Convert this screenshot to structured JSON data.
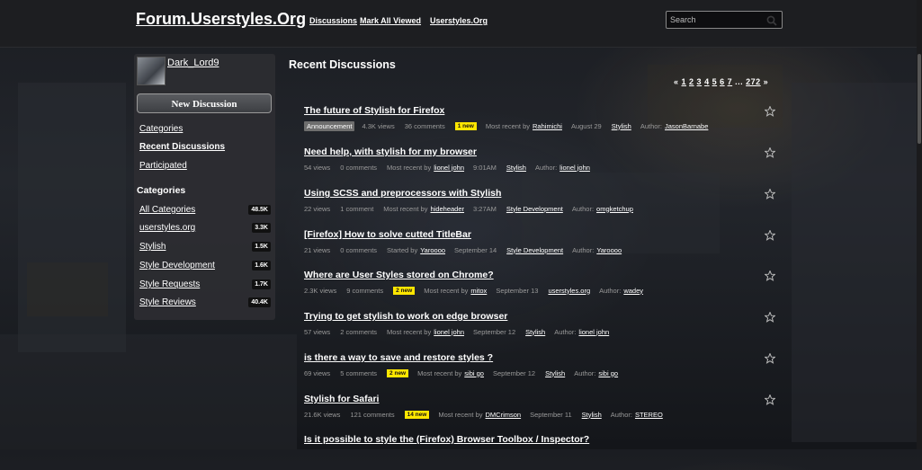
{
  "header": {
    "brand": "Forum.Userstyles.Org",
    "nav": [
      "Discussions",
      "Mark All Viewed",
      "Userstyles.Org"
    ],
    "search_placeholder": "Search"
  },
  "sidebar": {
    "username": "Dark_Lord9",
    "new_discussion": "New Discussion",
    "links": [
      "Categories",
      "Recent Discussions",
      "Participated"
    ],
    "active_link": "Recent Discussions",
    "categories_heading": "Categories",
    "categories": [
      {
        "label": "All Categories",
        "count": "48.5K"
      },
      {
        "label": "userstyles.org",
        "count": "3.3K"
      },
      {
        "label": "Stylish",
        "count": "1.5K"
      },
      {
        "label": "Style Development",
        "count": "1.6K"
      },
      {
        "label": "Style Requests",
        "count": "1.7K"
      },
      {
        "label": "Style Reviews",
        "count": "40.4K"
      }
    ]
  },
  "main": {
    "title": "Recent Discussions",
    "pager": {
      "prev": "«",
      "pages": [
        "1",
        "2",
        "3",
        "4",
        "5",
        "6",
        "7"
      ],
      "ellipsis": "...",
      "last": "272",
      "next": "»"
    },
    "discussions": [
      {
        "title": "The future of Stylish for Firefox",
        "tag": "Announcement",
        "views": "4.3K views",
        "comments": "36 comments",
        "new": "1 new",
        "recent_label": "Most recent by",
        "recent_user": "Rahimichi",
        "date": "August 29",
        "category": "Stylish",
        "author_label": "Author:",
        "author": "JasonBarnabe"
      },
      {
        "title": "Need help, with stylish for my browser",
        "tag": "",
        "views": "54 views",
        "comments": "0 comments",
        "new": "",
        "recent_label": "Most recent by",
        "recent_user": "lionel john",
        "date": "9:01AM",
        "category": "Stylish",
        "author_label": "Author:",
        "author": "lionel john"
      },
      {
        "title": "Using SCSS and preprocessors with Stylish",
        "tag": "",
        "views": "22 views",
        "comments": "1 comment",
        "new": "",
        "recent_label": "Most recent by",
        "recent_user": "hideheader",
        "date": "3:27AM",
        "category": "Style Development",
        "author_label": "Author:",
        "author": "omgketchup"
      },
      {
        "title": "[Firefox] How to solve cutted TitleBar",
        "tag": "",
        "views": "21 views",
        "comments": "0 comments",
        "new": "",
        "recent_label": "Started by",
        "recent_user": "Yaroooo",
        "date": "September 14",
        "category": "Style Development",
        "author_label": "Author:",
        "author": "Yaroooo"
      },
      {
        "title": "Where are User Styles stored on Chrome?",
        "tag": "",
        "views": "2.3K views",
        "comments": "9 comments",
        "new": "2 new",
        "recent_label": "Most recent by",
        "recent_user": "mitox",
        "date": "September 13",
        "category": "userstyles.org",
        "author_label": "Author:",
        "author": "wadey"
      },
      {
        "title": "Trying to get stylish to work on edge browser",
        "tag": "",
        "views": "57 views",
        "comments": "2 comments",
        "new": "",
        "recent_label": "Most recent by",
        "recent_user": "lionel john",
        "date": "September 12",
        "category": "Stylish",
        "author_label": "Author:",
        "author": "lionel john"
      },
      {
        "title": "is there a way to save and restore styles ?",
        "tag": "",
        "views": "69 views",
        "comments": "5 comments",
        "new": "2 new",
        "recent_label": "Most recent by",
        "recent_user": "sibi go",
        "date": "September 12",
        "category": "Stylish",
        "author_label": "Author:",
        "author": "sibi go"
      },
      {
        "title": "Stylish for Safari",
        "tag": "",
        "views": "21.6K views",
        "comments": "121 comments",
        "new": "14 new",
        "recent_label": "Most recent by",
        "recent_user": "DMCrimson",
        "date": "September 11",
        "category": "Stylish",
        "author_label": "Author:",
        "author": "STEREO"
      },
      {
        "title": "Is it possible to style the (Firefox) Browser Toolbox / Inspector?",
        "tag": "",
        "views": "",
        "comments": "",
        "new": "",
        "recent_label": "",
        "recent_user": "",
        "date": "",
        "category": "",
        "author_label": "",
        "author": ""
      }
    ]
  },
  "colors": {
    "new_badge": "#ffe600",
    "tag_bg": "#6e6e6e",
    "header_bg": "#1d1e21",
    "sidebar_bg": "#2d2e32"
  }
}
